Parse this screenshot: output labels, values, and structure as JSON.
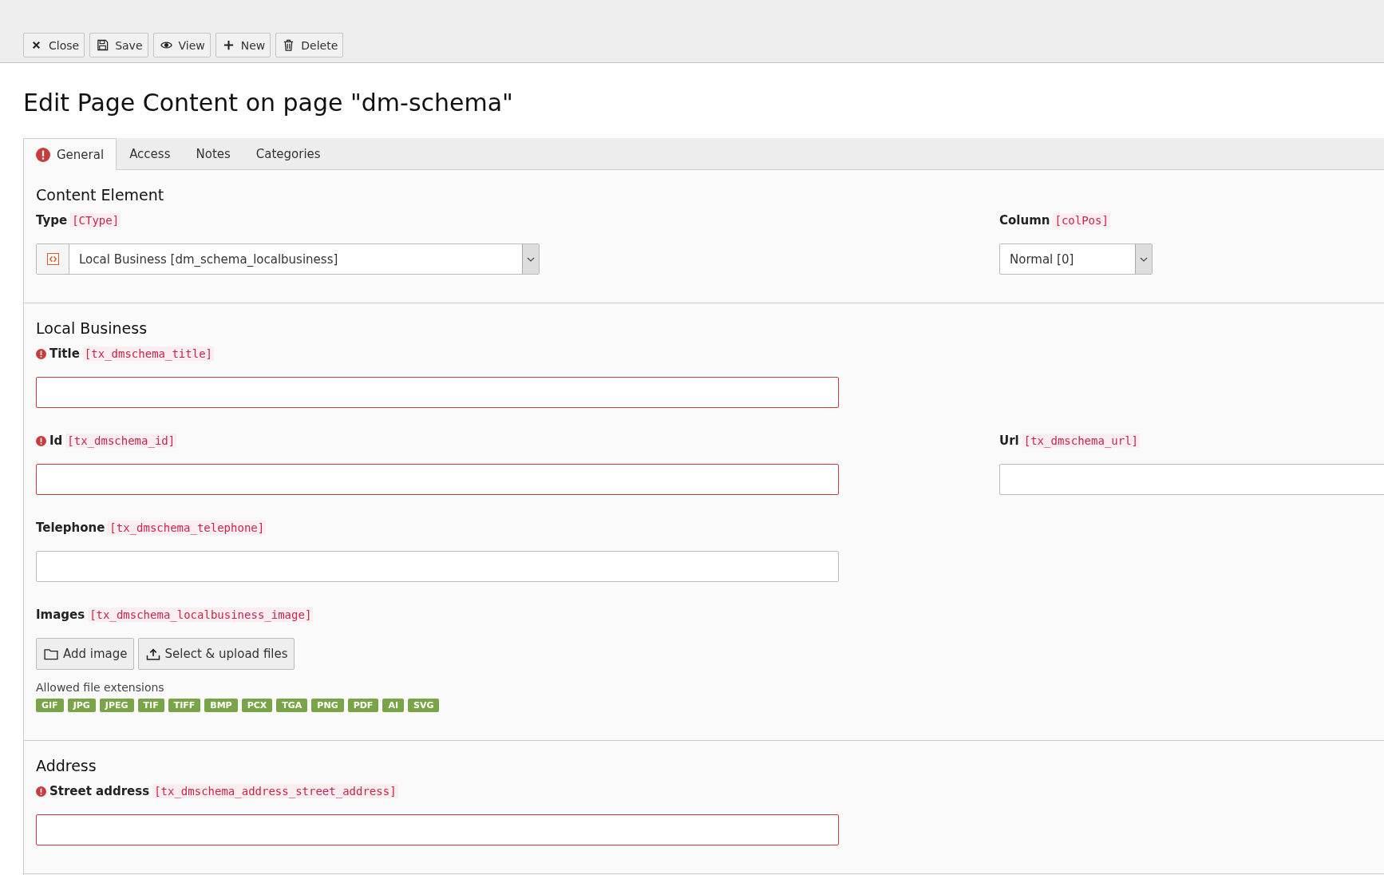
{
  "toolbar": [
    {
      "label": "Close"
    },
    {
      "label": "Save"
    },
    {
      "label": "View"
    },
    {
      "label": "New"
    },
    {
      "label": "Delete"
    }
  ],
  "title": "Edit Page Content on page \"dm-schema\"",
  "tabs": [
    {
      "label": "General",
      "selected": true,
      "error": true
    },
    {
      "label": "Access",
      "selected": false,
      "error": false
    },
    {
      "label": "Notes",
      "selected": false,
      "error": false
    },
    {
      "label": "Categories",
      "selected": false,
      "error": false
    }
  ],
  "sections": [
    {
      "title": "Content Element",
      "rows": [
        [
          {
            "kind": "select",
            "label": "Type",
            "code": "[CType]",
            "required": false,
            "value": "Local Business [dm_schema_localbusiness]",
            "type_icon": true
          },
          {
            "kind": "select",
            "label": "Column",
            "code": "[colPos]",
            "required": false,
            "value": "Normal [0]",
            "type_icon": false
          }
        ]
      ]
    },
    {
      "title": "Local Business",
      "rows": [
        [
          {
            "kind": "input",
            "label": "Title",
            "code": "[tx_dmschema_title]",
            "required": true
          }
        ],
        [
          {
            "kind": "input",
            "label": "Id",
            "code": "[tx_dmschema_id]",
            "required": true
          },
          {
            "kind": "input",
            "label": "Url",
            "code": "[tx_dmschema_url]",
            "required": false
          }
        ],
        [
          {
            "kind": "input",
            "label": "Telephone",
            "code": "[tx_dmschema_telephone]",
            "required": false
          }
        ],
        [
          {
            "kind": "files",
            "label": "Images",
            "code": "[tx_dmschema_localbusiness_image]",
            "required": false,
            "buttons": [
              {
                "label": "Add image"
              },
              {
                "label": "Select & upload files"
              }
            ],
            "note": "Allowed file extensions",
            "extensions": [
              "GIF",
              "JPG",
              "JPEG",
              "TIF",
              "TIFF",
              "BMP",
              "PCX",
              "TGA",
              "PNG",
              "PDF",
              "AI",
              "SVG"
            ]
          }
        ]
      ]
    },
    {
      "title": "Address",
      "rows": [
        [
          {
            "kind": "input",
            "label": "Street address",
            "code": "[tx_dmschema_address_street_address]",
            "required": true
          }
        ]
      ]
    }
  ]
}
